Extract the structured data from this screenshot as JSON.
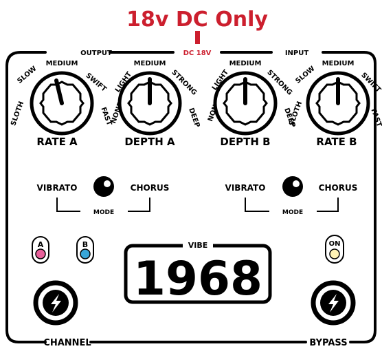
{
  "header": {
    "power_label": "18v DC Only"
  },
  "jacks": {
    "output": "OUTPUT",
    "dc": "DC 18V",
    "input": "INPUT"
  },
  "accent_color": "#cc1f2e",
  "knobs": [
    {
      "name": "RATE A",
      "scale": {
        "left": "SLOTH",
        "upper_left": "SLOW",
        "top": "MEDIUM",
        "upper_right": "SWIFT",
        "right": "FAST"
      }
    },
    {
      "name": "DEPTH A",
      "scale": {
        "left": "NONE",
        "upper_left": "LIGHT",
        "top": "MEDIUM",
        "upper_right": "STRONG",
        "right": "DEEP"
      }
    },
    {
      "name": "DEPTH B",
      "scale": {
        "left": "NONE",
        "upper_left": "LIGHT",
        "top": "MEDIUM",
        "upper_right": "STRONG",
        "right": "DEEP"
      }
    },
    {
      "name": "RATE B",
      "scale": {
        "left": "SLOTH",
        "upper_left": "SLOW",
        "top": "MEDIUM",
        "upper_right": "SWIFT",
        "right": "FAST"
      }
    }
  ],
  "mode_switches": [
    {
      "left": "VIBRATO",
      "right": "CHORUS",
      "label": "MODE"
    },
    {
      "left": "VIBRATO",
      "right": "CHORUS",
      "label": "MODE"
    }
  ],
  "leds": [
    {
      "label": "A",
      "color": "#e8609a"
    },
    {
      "label": "B",
      "color": "#38a6d8"
    },
    {
      "label": "ON",
      "color": "#fff3b5"
    }
  ],
  "display": {
    "caption": "VIBE",
    "title": "1968"
  },
  "footswitches": {
    "left_label": "CHANNEL",
    "right_label": "BYPASS"
  }
}
